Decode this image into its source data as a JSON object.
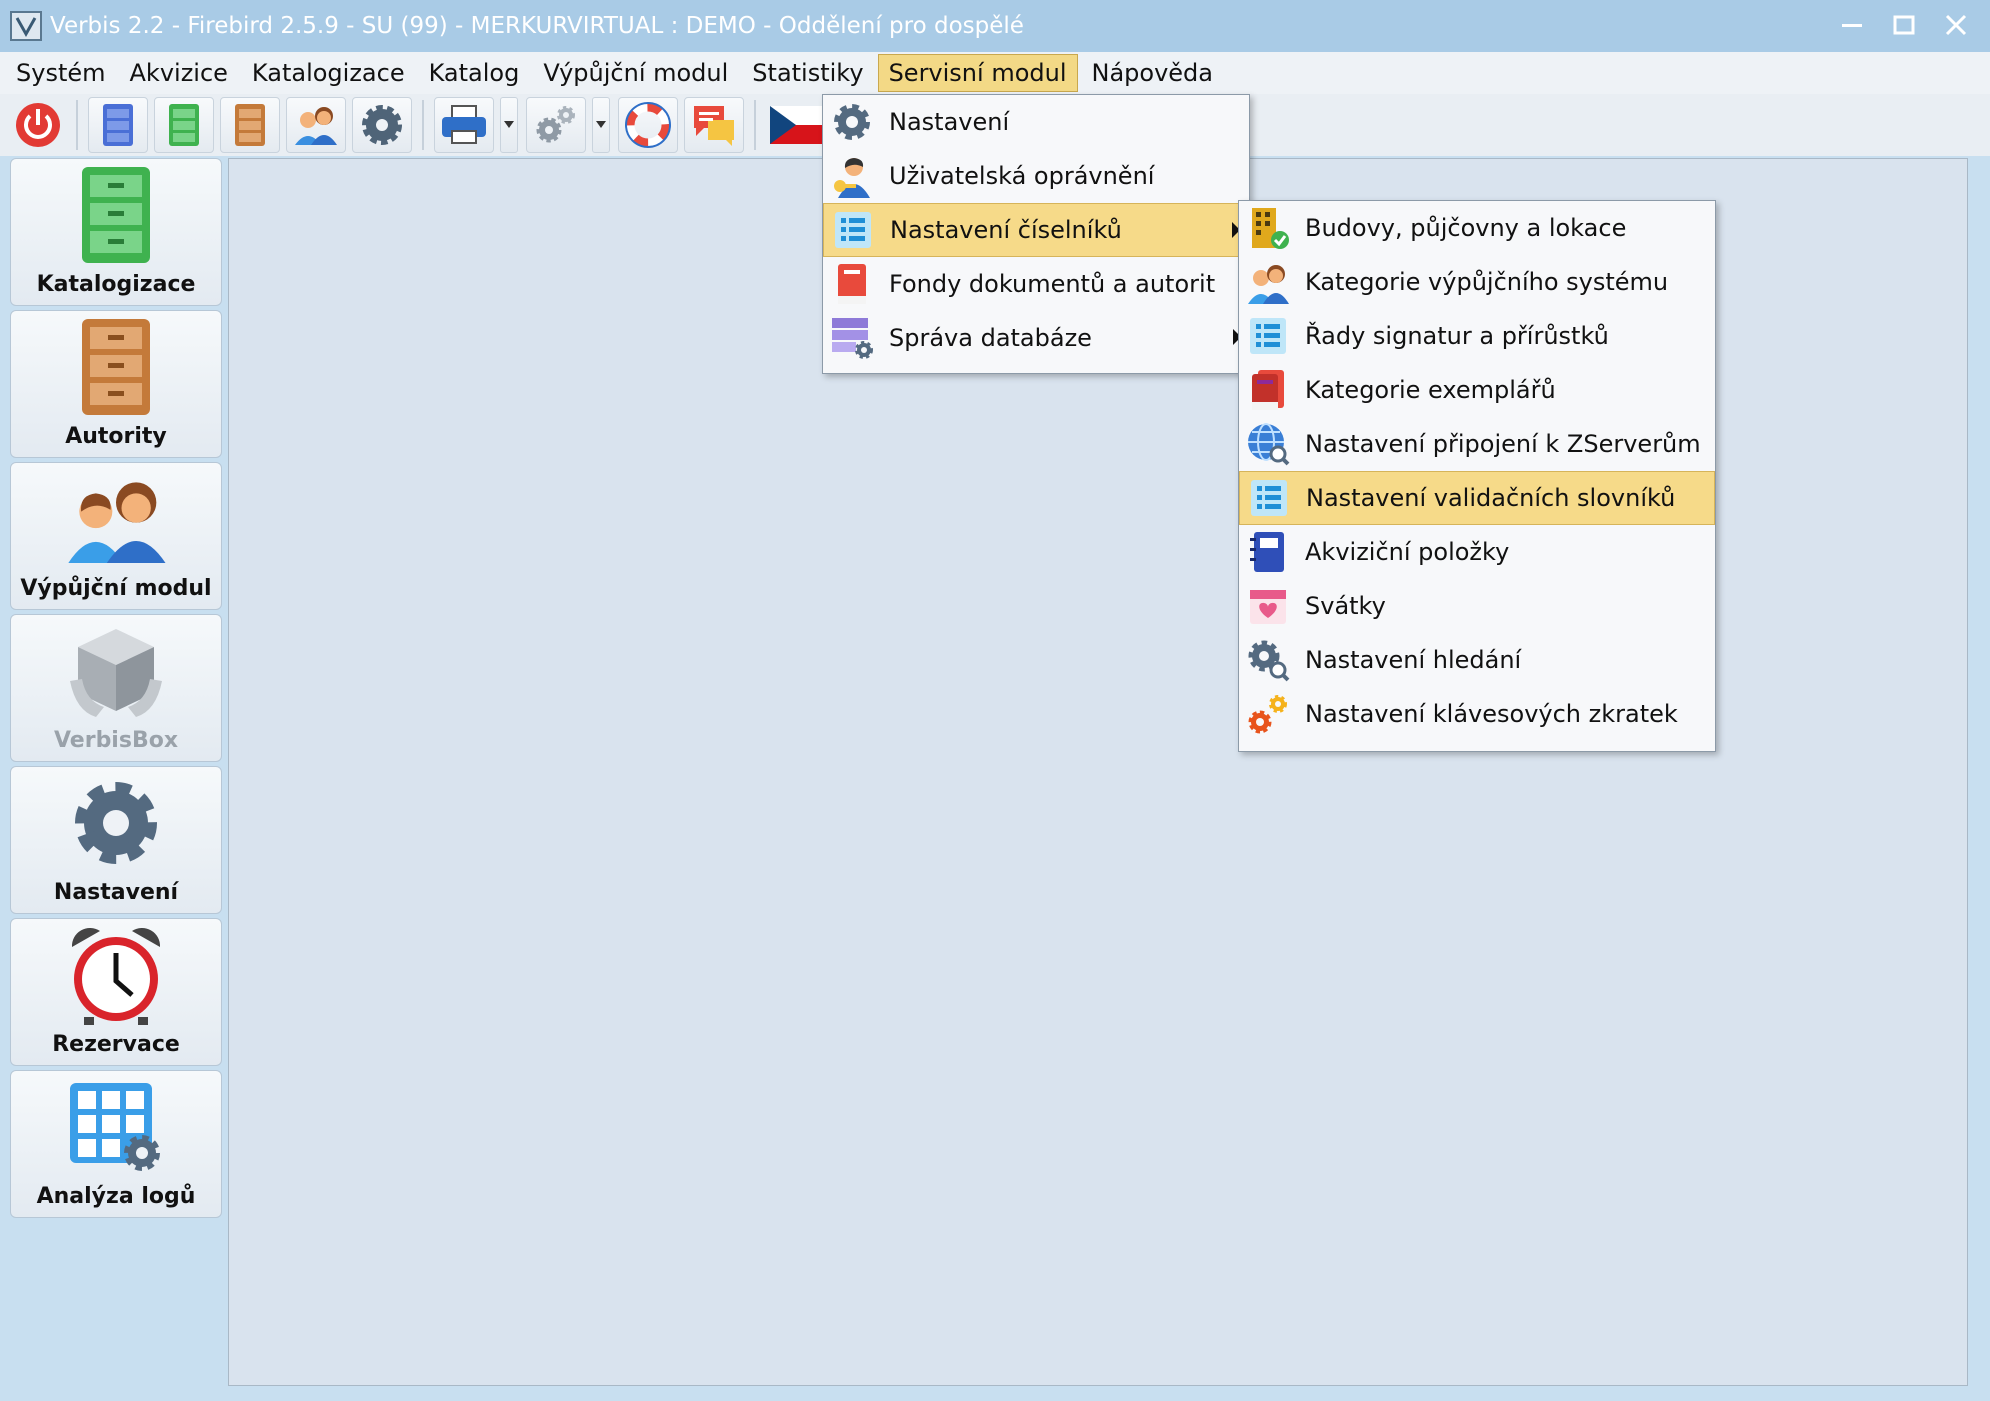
{
  "window": {
    "title": "Verbis 2.2 - Firebird 2.5.9 - SU (99) - MERKURVIRTUAL : DEMO - Oddělení pro dospělé"
  },
  "menubar": {
    "items": [
      {
        "label": "Systém"
      },
      {
        "label": "Akvizice"
      },
      {
        "label": "Katalogizace"
      },
      {
        "label": "Katalog"
      },
      {
        "label": "Výpůjční modul"
      },
      {
        "label": "Statistiky"
      },
      {
        "label": "Servisní modul"
      },
      {
        "label": "Nápověda"
      }
    ],
    "active_index": 6
  },
  "sidebar": {
    "items": [
      {
        "label": "Katalogizace",
        "icon": "green-cabinet-icon"
      },
      {
        "label": "Autority",
        "icon": "brown-cabinet-icon"
      },
      {
        "label": "Výpůjční modul",
        "icon": "users-icon"
      },
      {
        "label": "VerbisBox",
        "icon": "box-icon",
        "disabled": true
      },
      {
        "label": "Nastavení",
        "icon": "gear-icon"
      },
      {
        "label": "Rezervace",
        "icon": "alarm-clock-icon"
      },
      {
        "label": "Analýza logů",
        "icon": "grid-gear-icon"
      }
    ]
  },
  "servis_menu": {
    "items": [
      {
        "label": "Nastavení",
        "icon": "gear-icon"
      },
      {
        "label": "Uživatelská oprávnění",
        "icon": "user-key-icon"
      },
      {
        "label": "Nastavení číselníků",
        "icon": "list-icon",
        "submenu": true
      },
      {
        "label": "Fondy dokumentů a autorit",
        "icon": "book-icon"
      },
      {
        "label": "Správa databáze",
        "icon": "database-gear-icon",
        "submenu": true
      }
    ],
    "highlighted_index": 2
  },
  "ciselniky_menu": {
    "items": [
      {
        "label": "Budovy, půjčovny a lokace",
        "icon": "building-check-icon"
      },
      {
        "label": "Kategorie výpůjčního systému",
        "icon": "users-icon"
      },
      {
        "label": "Řady signatur a přírůstků",
        "icon": "list-icon"
      },
      {
        "label": "Kategorie exemplářů",
        "icon": "books-icon"
      },
      {
        "label": "Nastavení připojení k ZServerům",
        "icon": "globe-search-icon"
      },
      {
        "label": "Nastavení validačních slovníků",
        "icon": "list-icon"
      },
      {
        "label": "Akviziční položky",
        "icon": "notebook-icon"
      },
      {
        "label": "Svátky",
        "icon": "calendar-heart-icon"
      },
      {
        "label": "Nastavení hledání",
        "icon": "gear-search-icon"
      },
      {
        "label": "Nastavení klávesových zkratek",
        "icon": "gears-icon"
      }
    ],
    "highlighted_index": 5
  },
  "colors": {
    "titlebar": "#a9cbe6",
    "menu_highlight": "#f6da89",
    "workspace": "#d9e3ee"
  }
}
